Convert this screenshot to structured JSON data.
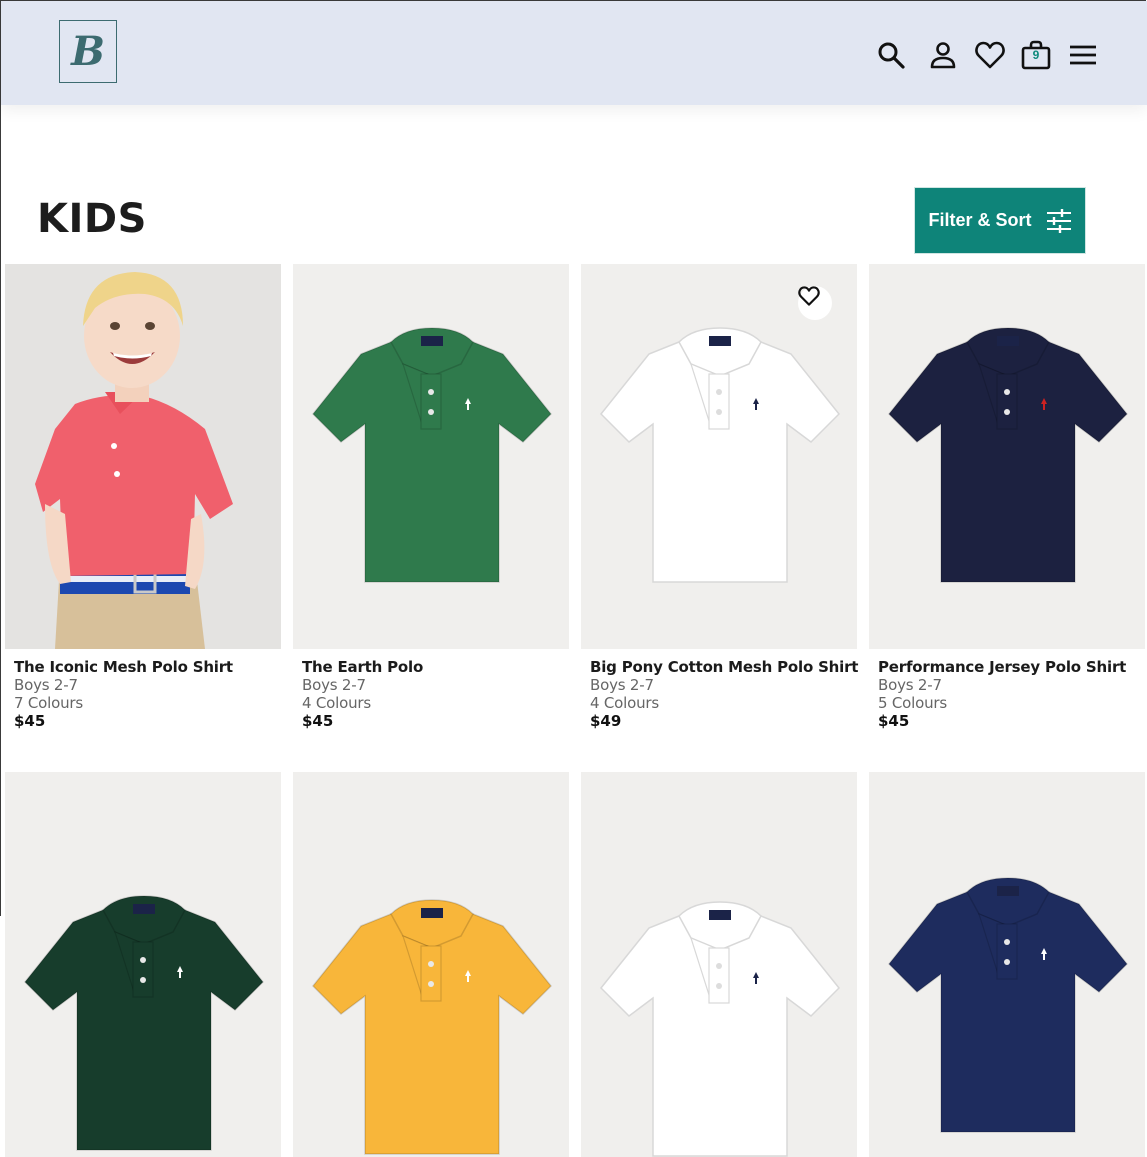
{
  "header": {
    "logo_letter": "B",
    "cart_count": "9",
    "icons": [
      "search-icon",
      "account-icon",
      "heart-icon",
      "bag-icon",
      "menu-icon"
    ],
    "background": "#e1e6f2"
  },
  "page": {
    "title": "KIDS",
    "filter_label": "Filter & Sort",
    "accent": "#0e8479"
  },
  "products": [
    {
      "name": "The Iconic Mesh Polo Shirt",
      "category": "Boys 2-7",
      "colours": "7 Colours",
      "price": "$45",
      "shirt_color": "#f06070",
      "image": "child-model"
    },
    {
      "name": "The Earth Polo",
      "category": "Boys 2-7",
      "colours": "4 Colours",
      "price": "$45",
      "shirt_color": "#2f7a4c",
      "image": "flat-polo"
    },
    {
      "name": "Big Pony Cotton Mesh Polo Shirt",
      "category": "Boys 2-7",
      "colours": "4 Colours",
      "price": "$49",
      "shirt_color": "#ffffff",
      "image": "flat-polo"
    },
    {
      "name": "Performance Jersey Polo Shirt",
      "category": "Boys 2-7",
      "colours": "5 Colours",
      "price": "$45",
      "shirt_color": "#1c2140",
      "image": "flat-polo"
    },
    {
      "shirt_color": "#173d2c",
      "image": "flat-polo"
    },
    {
      "shirt_color": "#f8b63a",
      "image": "flat-polo"
    },
    {
      "shirt_color": "#ffffff",
      "image": "flat-polo"
    },
    {
      "shirt_color": "#1e2c5e",
      "image": "flat-polo"
    }
  ]
}
